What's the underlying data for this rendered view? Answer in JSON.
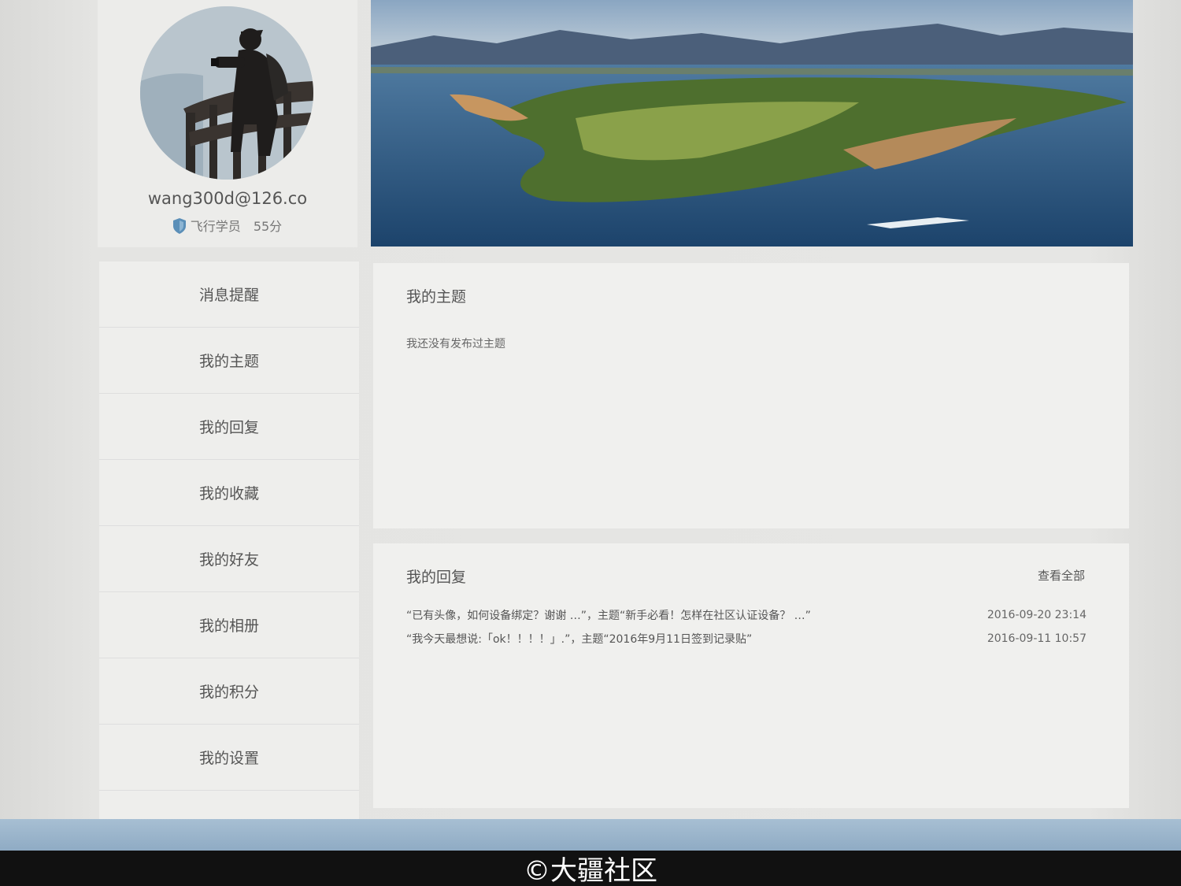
{
  "profile": {
    "username": "wang300d@126.co",
    "rank": "飞行学员",
    "score": "55分"
  },
  "menu": [
    {
      "label": "消息提醒"
    },
    {
      "label": "我的主题"
    },
    {
      "label": "我的回复"
    },
    {
      "label": "我的收藏"
    },
    {
      "label": "我的好友"
    },
    {
      "label": "我的相册"
    },
    {
      "label": "我的积分"
    },
    {
      "label": "我的设置"
    }
  ],
  "topics": {
    "title": "我的主题",
    "empty_text": "我还没有发布过主题"
  },
  "replies": {
    "title": "我的回复",
    "view_all": "查看全部",
    "items": [
      {
        "text": "“已有头像，如何设备绑定？谢谢 …”，主题“新手必看！怎样在社区认证设备？ …”",
        "time": "2016-09-20 23:14"
      },
      {
        "text": "“我今天最想说:「ok！！！！」.”，主题“2016年9月11日签到记录贴”",
        "time": "2016-09-11 10:57"
      }
    ]
  },
  "watermark": "©大疆社区",
  "colors": {
    "rank_shield": "#5b8fb8",
    "banner_water": "#27507a"
  }
}
